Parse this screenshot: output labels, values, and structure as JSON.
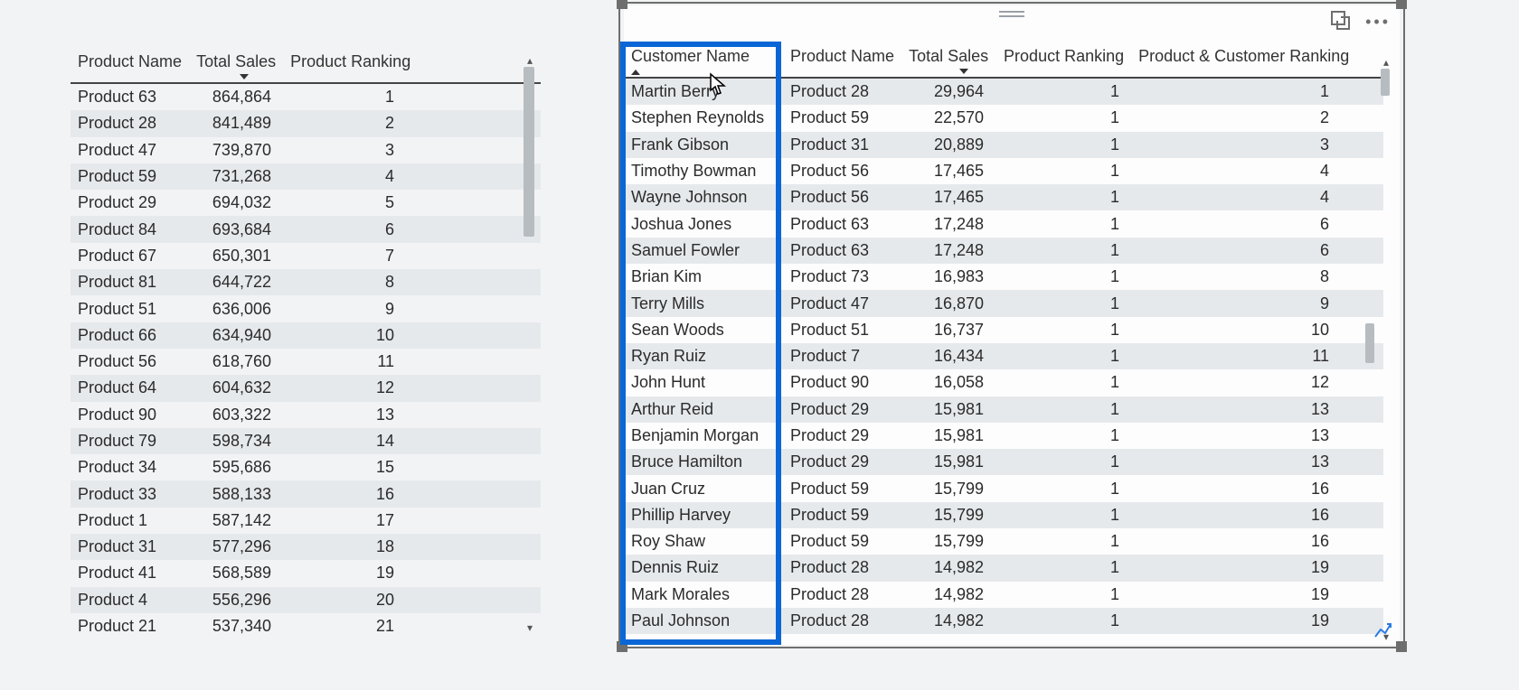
{
  "left_table": {
    "headers": {
      "product": "Product Name",
      "sales": "Total Sales",
      "ranking": "Product Ranking"
    },
    "rows": [
      {
        "product": "Product 63",
        "sales": "864,864",
        "rank": "1"
      },
      {
        "product": "Product 28",
        "sales": "841,489",
        "rank": "2"
      },
      {
        "product": "Product 47",
        "sales": "739,870",
        "rank": "3"
      },
      {
        "product": "Product 59",
        "sales": "731,268",
        "rank": "4"
      },
      {
        "product": "Product 29",
        "sales": "694,032",
        "rank": "5"
      },
      {
        "product": "Product 84",
        "sales": "693,684",
        "rank": "6"
      },
      {
        "product": "Product 67",
        "sales": "650,301",
        "rank": "7"
      },
      {
        "product": "Product 81",
        "sales": "644,722",
        "rank": "8"
      },
      {
        "product": "Product 51",
        "sales": "636,006",
        "rank": "9"
      },
      {
        "product": "Product 66",
        "sales": "634,940",
        "rank": "10"
      },
      {
        "product": "Product 56",
        "sales": "618,760",
        "rank": "11"
      },
      {
        "product": "Product 64",
        "sales": "604,632",
        "rank": "12"
      },
      {
        "product": "Product 90",
        "sales": "603,322",
        "rank": "13"
      },
      {
        "product": "Product 79",
        "sales": "598,734",
        "rank": "14"
      },
      {
        "product": "Product 34",
        "sales": "595,686",
        "rank": "15"
      },
      {
        "product": "Product 33",
        "sales": "588,133",
        "rank": "16"
      },
      {
        "product": "Product 1",
        "sales": "587,142",
        "rank": "17"
      },
      {
        "product": "Product 31",
        "sales": "577,296",
        "rank": "18"
      },
      {
        "product": "Product 41",
        "sales": "568,589",
        "rank": "19"
      },
      {
        "product": "Product 4",
        "sales": "556,296",
        "rank": "20"
      },
      {
        "product": "Product 21",
        "sales": "537,340",
        "rank": "21"
      }
    ]
  },
  "right_table": {
    "headers": {
      "customer": "Customer Name",
      "product": "Product Name",
      "sales": "Total Sales",
      "ranking": "Product Ranking",
      "ranking2": "Product & Customer Ranking"
    },
    "rows": [
      {
        "customer": "Martin Berry",
        "product": "Product 28",
        "sales": "29,964",
        "rank": "1",
        "rank2": "1"
      },
      {
        "customer": "Stephen Reynolds",
        "product": "Product 59",
        "sales": "22,570",
        "rank": "1",
        "rank2": "2"
      },
      {
        "customer": "Frank Gibson",
        "product": "Product 31",
        "sales": "20,889",
        "rank": "1",
        "rank2": "3"
      },
      {
        "customer": "Timothy Bowman",
        "product": "Product 56",
        "sales": "17,465",
        "rank": "1",
        "rank2": "4"
      },
      {
        "customer": "Wayne Johnson",
        "product": "Product 56",
        "sales": "17,465",
        "rank": "1",
        "rank2": "4"
      },
      {
        "customer": "Joshua Jones",
        "product": "Product 63",
        "sales": "17,248",
        "rank": "1",
        "rank2": "6"
      },
      {
        "customer": "Samuel Fowler",
        "product": "Product 63",
        "sales": "17,248",
        "rank": "1",
        "rank2": "6"
      },
      {
        "customer": "Brian Kim",
        "product": "Product 73",
        "sales": "16,983",
        "rank": "1",
        "rank2": "8"
      },
      {
        "customer": "Terry Mills",
        "product": "Product 47",
        "sales": "16,870",
        "rank": "1",
        "rank2": "9"
      },
      {
        "customer": "Sean Woods",
        "product": "Product 51",
        "sales": "16,737",
        "rank": "1",
        "rank2": "10"
      },
      {
        "customer": "Ryan Ruiz",
        "product": "Product 7",
        "sales": "16,434",
        "rank": "1",
        "rank2": "11"
      },
      {
        "customer": "John Hunt",
        "product": "Product 90",
        "sales": "16,058",
        "rank": "1",
        "rank2": "12"
      },
      {
        "customer": "Arthur Reid",
        "product": "Product 29",
        "sales": "15,981",
        "rank": "1",
        "rank2": "13"
      },
      {
        "customer": "Benjamin Morgan",
        "product": "Product 29",
        "sales": "15,981",
        "rank": "1",
        "rank2": "13"
      },
      {
        "customer": "Bruce Hamilton",
        "product": "Product 29",
        "sales": "15,981",
        "rank": "1",
        "rank2": "13"
      },
      {
        "customer": "Juan Cruz",
        "product": "Product 59",
        "sales": "15,799",
        "rank": "1",
        "rank2": "16"
      },
      {
        "customer": "Phillip Harvey",
        "product": "Product 59",
        "sales": "15,799",
        "rank": "1",
        "rank2": "16"
      },
      {
        "customer": "Roy Shaw",
        "product": "Product 59",
        "sales": "15,799",
        "rank": "1",
        "rank2": "16"
      },
      {
        "customer": "Dennis Ruiz",
        "product": "Product 28",
        "sales": "14,982",
        "rank": "1",
        "rank2": "19"
      },
      {
        "customer": "Mark Morales",
        "product": "Product 28",
        "sales": "14,982",
        "rank": "1",
        "rank2": "19"
      },
      {
        "customer": "Paul Johnson",
        "product": "Product 28",
        "sales": "14,982",
        "rank": "1",
        "rank2": "19"
      }
    ]
  }
}
